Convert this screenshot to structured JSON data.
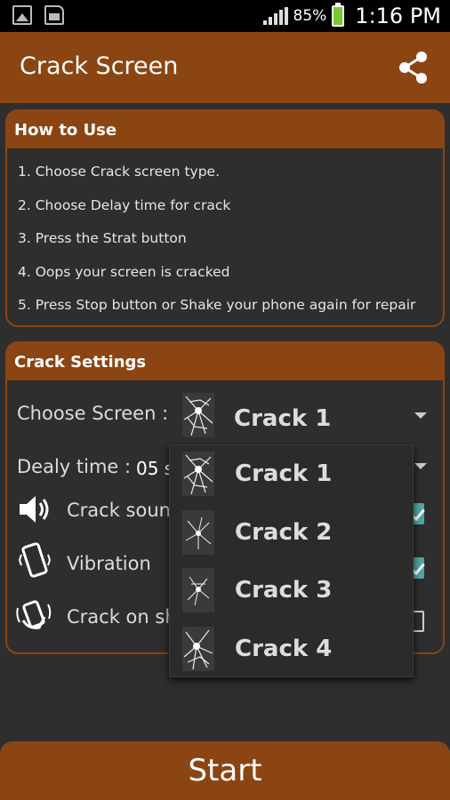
{
  "status_bar": {
    "battery_pct": "85%",
    "time": "1:16 PM"
  },
  "app": {
    "title": "Crack Screen",
    "share_icon": "share-icon"
  },
  "how_to_use": {
    "title": "How to Use",
    "steps": [
      "1. Choose Crack screen type.",
      "2. Choose Delay time for crack",
      "3. Press the Strat button",
      "4. Oops your screen is cracked",
      "5. Press Stop button or Shake your phone again for repair"
    ]
  },
  "crack_settings": {
    "title": "Crack Settings",
    "choose_screen_label": "Choose Screen :",
    "choose_screen_value": "Crack 1",
    "delay_label": "Dealy time :",
    "delay_value": "05 s",
    "options": [
      {
        "label": "Crack soun",
        "icon": "speaker-icon",
        "checked": true
      },
      {
        "label": "Vibration",
        "icon": "phone-vibrate-icon",
        "checked": true
      },
      {
        "label": "Crack on sh",
        "icon": "hand-shake-icon",
        "checked": false
      }
    ]
  },
  "dropdown": {
    "items": [
      "Crack 1",
      "Crack 2",
      "Crack 3",
      "Crack 4"
    ]
  },
  "start_label": "Start",
  "colors": {
    "brand": "#8b4513",
    "background": "#2e2e2e",
    "check_accent": "#4ea7a6"
  }
}
